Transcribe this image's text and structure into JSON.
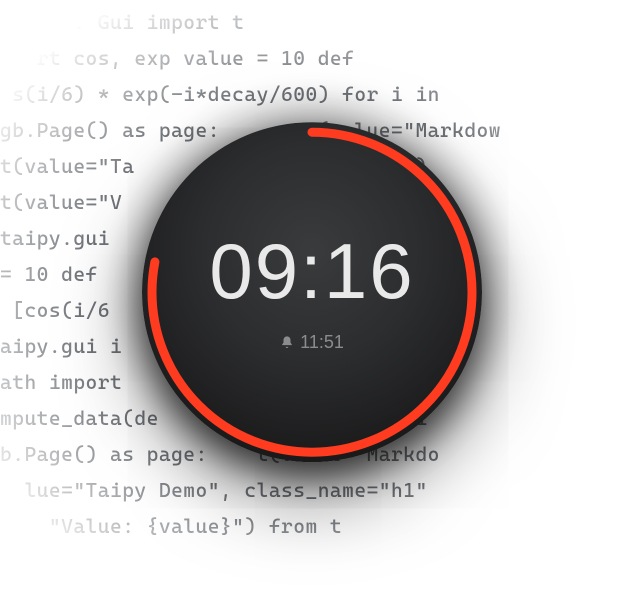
{
  "code_lines": [
    "      . Gui import t",
    "   rt cos, exp value = 10 def ",
    " s(i/6) * exp(-i*decay/600) for i in ",
    "gb.Page() as page:      xt(value=\"Markdow",
    "t(value=\"Ta               ame=\"h1\")",
    "t(value=\"V                taipy.gui ",
    "taipy.gui                  h import",
    "= 10 def                    ist:",
    " [cos(i/6                  i in ra",
    "aipy.gui i                gui.build",
    "ath import              ",
    "mpute_data(de          eturn [cos(i",
    "b.Page() as page:    t(value=\"Markdo",
    "  lue=\"Taipy Demo\", class_name=\"h1\"",
    "    \"Value: {value}\") from t  "
  ],
  "clock": {
    "time": "09:16",
    "alarm_time": "11:51",
    "progress_fraction": 0.78,
    "accent_color": "#ff3b20"
  }
}
